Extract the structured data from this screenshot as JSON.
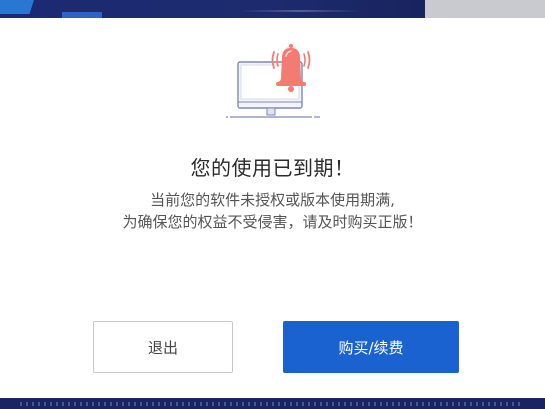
{
  "dialog": {
    "title": "您的使用已到期！",
    "message_line1": "当前您的软件未授权或版本使用期满,",
    "message_line2": "为确保您的权益不受侵害，请及时购买正版！",
    "buttons": {
      "exit_label": "退出",
      "buy_label": "购买/续费"
    }
  },
  "icons": {
    "illustration": "monitor-with-alarm-bell-icon"
  },
  "colors": {
    "primary_button": "#1a62cf",
    "bell": "#f47b72",
    "background_app": "#1b2a74"
  }
}
